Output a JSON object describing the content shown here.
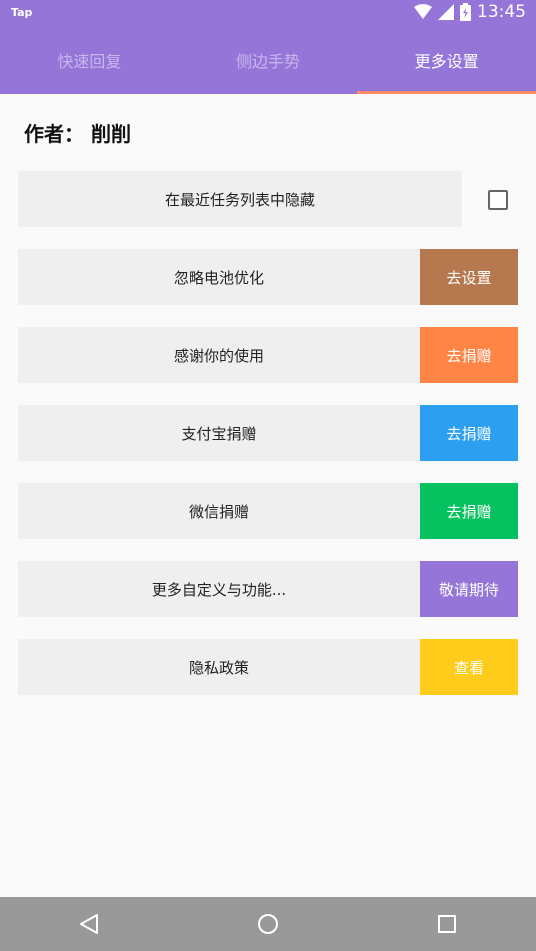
{
  "status_bar": {
    "app_label": "Tap",
    "time": "13:45"
  },
  "tabs": [
    {
      "label": "快速回复",
      "active": false
    },
    {
      "label": "侧边手势",
      "active": false
    },
    {
      "label": "更多设置",
      "active": true
    }
  ],
  "author": "作者： 削削",
  "settings": [
    {
      "label": "在最近任务列表中隐藏",
      "control": "checkbox",
      "checked": false
    },
    {
      "label": "忽略电池优化",
      "button_label": "去设置",
      "button_color": "#b5784f"
    },
    {
      "label": "感谢你的使用",
      "button_label": "去捐赠",
      "button_color": "#ff8547"
    },
    {
      "label": "支付宝捐赠",
      "button_label": "去捐赠",
      "button_color": "#2d9ff0"
    },
    {
      "label": "微信捐赠",
      "button_label": "去捐赠",
      "button_color": "#06c160"
    },
    {
      "label": "更多自定义与功能...",
      "button_label": "敬请期待",
      "button_color": "#9575d8"
    },
    {
      "label": "隐私政策",
      "button_label": "查看",
      "button_color": "#ffcc1c"
    }
  ],
  "nav": [
    "back-icon",
    "home-icon",
    "recents-icon"
  ]
}
